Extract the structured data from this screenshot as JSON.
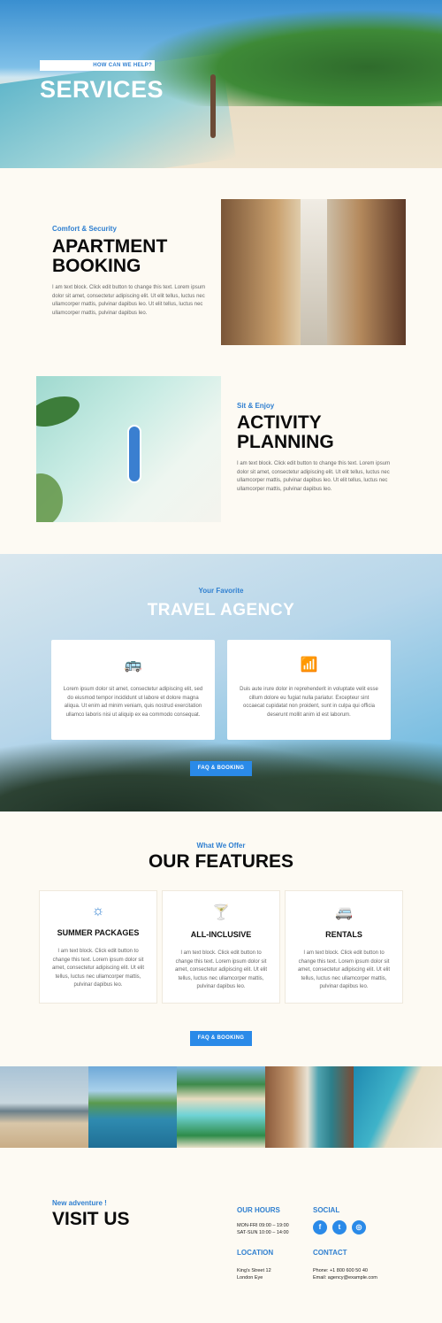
{
  "hero": {
    "kicker": "HOW CAN WE HELP?",
    "title": "SERVICES"
  },
  "apartment": {
    "kicker": "Comfort & Security",
    "title_line1": "APARTMENT",
    "title_line2": "BOOKING",
    "body": "I am text block. Click edit button to change this text. Lorem ipsum dolor sit amet, consectetur adipiscing elit. Ut elit tellus, luctus nec ullamcorper mattis, pulvinar dapibus leo. Ut elit tellus, luctus nec ullamcorper mattis, pulvinar dapibus leo."
  },
  "activity": {
    "kicker": "Sit & Enjoy",
    "title_line1": "ACTIVITY",
    "title_line2": "PLANNING",
    "body": "I am text block. Click edit button to change this text. Lorem ipsum dolor sit amet, consectetur adipiscing elit. Ut elit tellus, luctus nec ullamcorper mattis, pulvinar dapibus leo. Ut elit tellus, luctus nec ullamcorper mattis, pulvinar dapibus leo."
  },
  "agency": {
    "kicker": "Your Favorite",
    "title": "TRAVEL AGENCY",
    "cards": [
      {
        "icon": "bus-icon",
        "text": "Lorem ipsum dolor sit amet, consectetur adipiscing elit, sed do eiusmod tempor incididunt ut labore et dolore magna aliqua. Ut enim ad minim veniam, quis nostrud exercitation ullamco laboris nisi ut aliquip ex ea commodo consequat."
      },
      {
        "icon": "wifi-icon",
        "text": "Duis aute irure dolor in reprehenderit in voluptate velit esse cillum dolore eu fugiat nulla pariatur. Excepteur sint occaecat cupidatat non proident, sunt in culpa qui officia deserunt mollit anim id est laborum."
      }
    ],
    "button": "FAQ & BOOKING"
  },
  "features": {
    "kicker": "What We Offer",
    "title": "OUR FEATURES",
    "items": [
      {
        "icon": "sun-icon",
        "title": "SUMMER PACKAGES",
        "text": "I am text block. Click edit button to change this text. Lorem ipsum dolor sit amet, consectetur adipiscing elit. Ut elit tellus, luctus nec ullamcorper mattis, pulvinar dapibus leo."
      },
      {
        "icon": "cocktail-icon",
        "title": "ALL-INCLUSIVE",
        "text": "I am text block. Click edit button to change this text. Lorem ipsum dolor sit amet, consectetur adipiscing elit. Ut elit tellus, luctus nec ullamcorper mattis, pulvinar dapibus leo."
      },
      {
        "icon": "camper-icon",
        "title": "RENTALS",
        "text": "I am text block. Click edit button to change this text. Lorem ipsum dolor sit amet, consectetur adipiscing elit. Ut elit tellus, luctus nec ullamcorper mattis, pulvinar dapibus leo."
      }
    ],
    "button": "FAQ & BOOKING"
  },
  "footer": {
    "kicker": "New adventure !",
    "title": "VISIT US",
    "hours_title": "OUR HOURS",
    "hours_line1": "MON-FRI 09:00 – 19:00",
    "hours_line2": "SAT-SUN 10:00 – 14:00",
    "social_title": "SOCIAL",
    "location_title": "LOCATION",
    "location_line1": "King's Street 12",
    "location_line2": "London Eye",
    "contact_title": "CONTACT",
    "contact_line1": "Phone: +1 800 600 50 40",
    "contact_line2": "Email: agency@example.com"
  },
  "colors": {
    "accent": "#2a8ae8",
    "kicker": "#2f7fd0",
    "background": "#fdfaf3"
  }
}
